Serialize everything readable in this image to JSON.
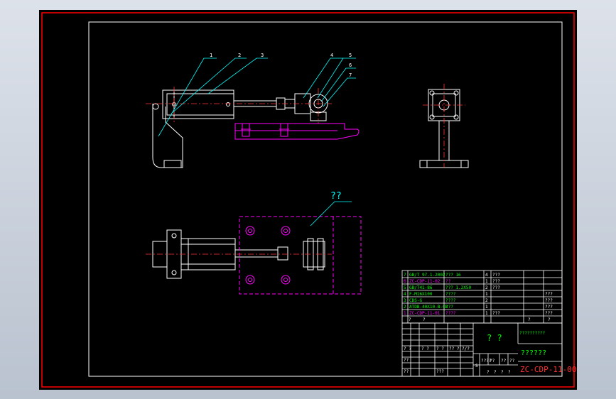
{
  "colors": {
    "background": "#000000",
    "border": "#ff0000",
    "frame": "#ffffff",
    "part": "#ffffff",
    "base": "#ff00ff",
    "leader": "#00ffff",
    "centerline": "#ff3333",
    "bom_text": "#00ff00",
    "bom_text_alt": "#ff00ff",
    "title_text": "#ff3333"
  },
  "drawing": {
    "callouts": [
      "1",
      "2",
      "3",
      "4",
      "5",
      "6",
      "7"
    ],
    "plan_label": "??"
  },
  "bom": {
    "rows": [
      {
        "no": "7",
        "code": "GB/T 97.1-2002",
        "name": "??? 16",
        "qty": "4",
        "mat": "???",
        "note": ""
      },
      {
        "no": "6",
        "code": "ZC-CDP-11-02",
        "name": "??",
        "qty": "1",
        "mat": "???",
        "note": ""
      },
      {
        "no": "5",
        "code": "GB/T41-86",
        "name": "??? 1.2X50",
        "qty": "2",
        "mat": "???",
        "note": ""
      },
      {
        "no": "4",
        "code": "F-M16X100",
        "name": "????",
        "qty": "1",
        "mat": "",
        "note": "???"
      },
      {
        "no": "3",
        "code": "CDS-G",
        "name": "????",
        "qty": "2",
        "mat": "",
        "note": "???"
      },
      {
        "no": "2",
        "code": "ATDB-40X10-B-CB",
        "name": "???",
        "qty": "1",
        "mat": "",
        "note": "???"
      },
      {
        "no": "1",
        "code": "ZC-CDP-11-01",
        "name": "????",
        "qty": "1",
        "mat": "???",
        "note": "???"
      }
    ],
    "header": [
      "?",
      "?",
      "?",
      "?"
    ]
  },
  "title_block": {
    "part_name": "? ?",
    "company_logo": "??????????",
    "drawing_name": "??????",
    "drawing_number": "ZC-CDP-11-00",
    "sig_labels": [
      "? ?",
      "? ?",
      "? ?",
      "?? ?",
      "?/?",
      "???"
    ],
    "scale_labels": [
      "????",
      "??",
      "??",
      "??"
    ],
    "sheet_labels": [
      "?",
      "?",
      "?",
      "?"
    ],
    "side_labels": [
      "??",
      "??"
    ],
    "mark": "S"
  }
}
